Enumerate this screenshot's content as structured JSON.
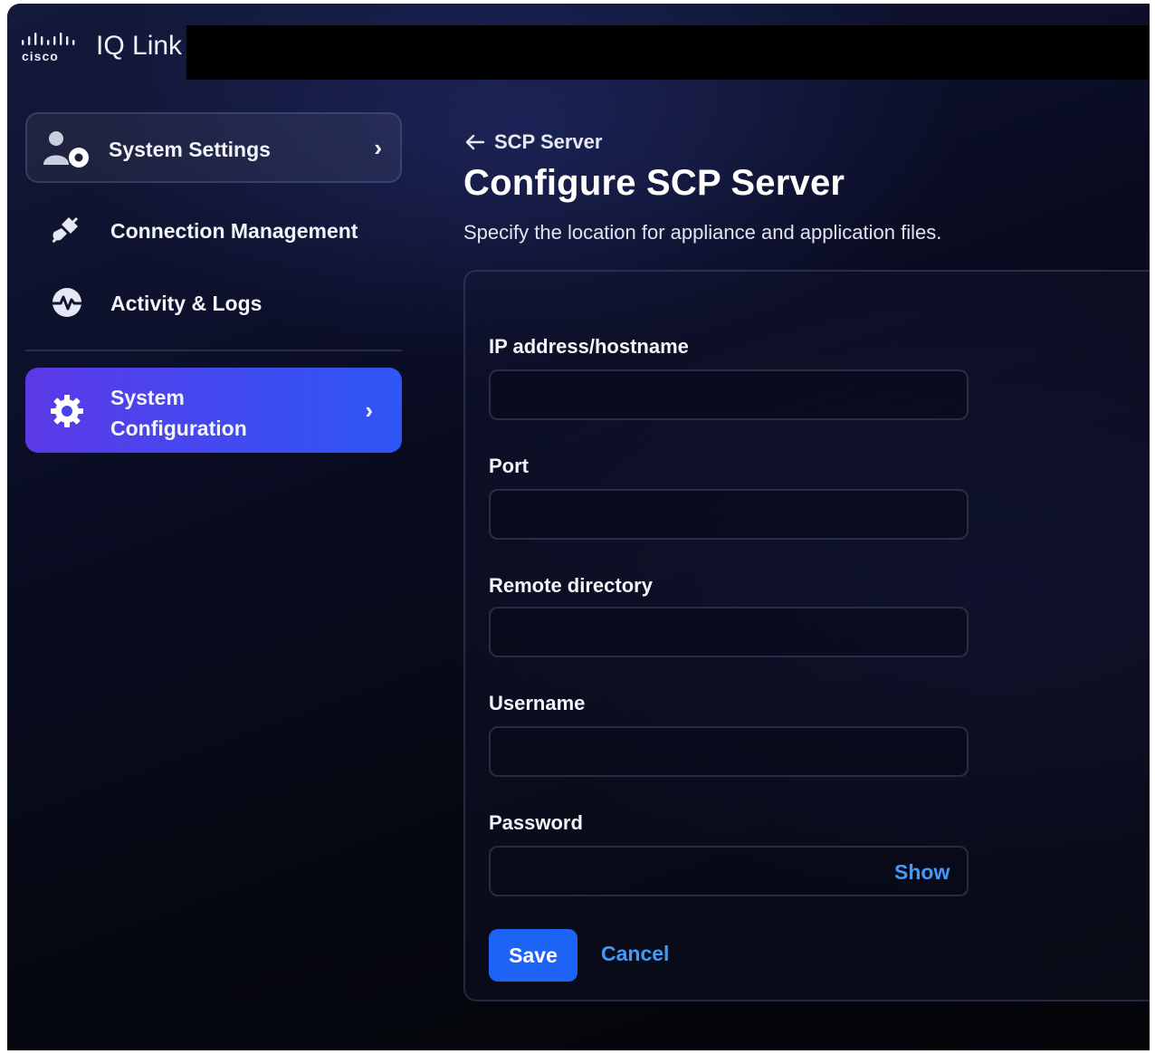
{
  "header": {
    "brand_wordmark": "cisco",
    "app_name": "IQ Link",
    "logo_icon": "cisco-bars-icon"
  },
  "sidebar": {
    "items": [
      {
        "label": "System Settings",
        "icon": "user-gear-icon",
        "chevron": "›"
      },
      {
        "label": "Connection Management",
        "icon": "plug-icon"
      },
      {
        "label": "Activity & Logs",
        "icon": "activity-pulse-icon"
      },
      {
        "label": "System Configuration",
        "icon": "gear-icon",
        "chevron": "›",
        "active": true
      }
    ]
  },
  "main": {
    "breadcrumb": "SCP Server",
    "title": "Configure SCP Server",
    "description": "Specify the location for appliance and application files.",
    "form": {
      "fields": [
        {
          "label": "IP address/hostname",
          "value": ""
        },
        {
          "label": "Port",
          "value": ""
        },
        {
          "label": "Remote directory",
          "value": ""
        },
        {
          "label": "Username",
          "value": ""
        },
        {
          "label": "Password",
          "value": ""
        }
      ],
      "show_label": "Show",
      "save_label": "Save",
      "cancel_label": "Cancel"
    }
  },
  "colors": {
    "accent": "#1d63f5",
    "link": "#3f9bff",
    "active_nav_start": "#5b39e6",
    "active_nav_end": "#2f56f5",
    "background": "#05070f"
  }
}
